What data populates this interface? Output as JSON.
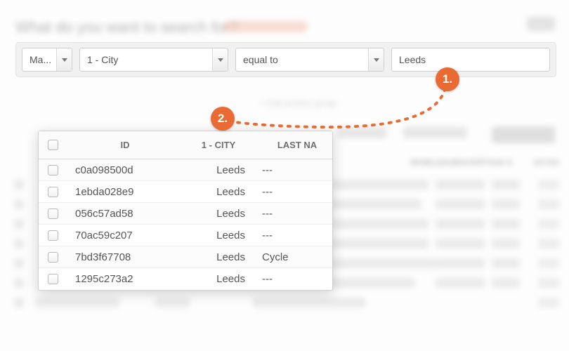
{
  "page_title": "What do you want to search for?",
  "add_group_label": "+ Add another group",
  "filter": {
    "match_label": "Ma...",
    "field_label": "1 - City",
    "operator_label": "equal to",
    "value": "Leeds"
  },
  "callouts": {
    "one": "1.",
    "two": "2."
  },
  "bg_columns": {
    "mobile": "MOBILE",
    "subscription": "SUBSCRIPTION S",
    "actions": "ACTIO"
  },
  "table": {
    "headers": {
      "id": "ID",
      "city": "1 - CITY",
      "last": "LAST NA"
    },
    "rows": [
      {
        "id": "c0a098500d",
        "city": "Leeds",
        "last": "---"
      },
      {
        "id": "1ebda028e9",
        "city": "Leeds",
        "last": "---"
      },
      {
        "id": "056c57ad58",
        "city": "Leeds",
        "last": "---"
      },
      {
        "id": "70ac59c207",
        "city": "Leeds",
        "last": "---"
      },
      {
        "id": "7bd3f67708",
        "city": "Leeds",
        "last": "Cycle"
      },
      {
        "id": "1295c273a2",
        "city": "Leeds",
        "last": "---"
      }
    ]
  },
  "colors": {
    "accent": "#e96b33"
  }
}
